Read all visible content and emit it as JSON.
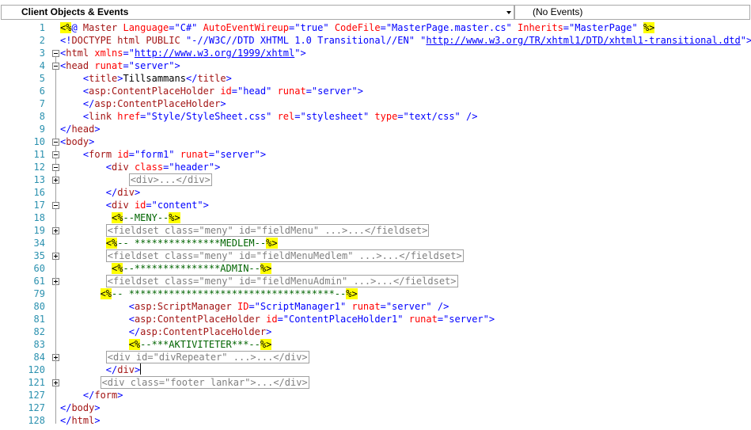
{
  "toolbar": {
    "left_dropdown": "Client Objects & Events",
    "right_dropdown": "(No Events)"
  },
  "lines": [
    {
      "num": "1",
      "fold": "",
      "ind": 0,
      "segs": [
        [
          "hl",
          "<%"
        ],
        [
          "b",
          "@ "
        ],
        [
          "m",
          "Master "
        ],
        [
          "a",
          "Language"
        ],
        [
          "b",
          "=\"C#\" "
        ],
        [
          "a",
          "AutoEventWireup"
        ],
        [
          "b",
          "=\"true\" "
        ],
        [
          "a",
          "CodeFile"
        ],
        [
          "b",
          "=\"MasterPage.master.cs\" "
        ],
        [
          "a",
          "Inherits"
        ],
        [
          "b",
          "=\"MasterPage\" "
        ],
        [
          "hl",
          "%>"
        ]
      ]
    },
    {
      "num": "2",
      "fold": "",
      "ind": 0,
      "segs": [
        [
          "b",
          "<!"
        ],
        [
          "m",
          "DOCTYPE html PUBLIC "
        ],
        [
          "b",
          "\"-//W3C//DTD XHTML 1.0 Transitional//EN\" \""
        ],
        [
          "u",
          "http://www.w3.org/TR/xhtml1/DTD/xhtml1-transitional.dtd"
        ],
        [
          "b",
          "\">"
        ]
      ]
    },
    {
      "num": "3",
      "fold": "minus",
      "ind": 0,
      "segs": [
        [
          "b",
          "<"
        ],
        [
          "m",
          "html "
        ],
        [
          "a",
          "xmlns"
        ],
        [
          "b",
          "=\""
        ],
        [
          "u",
          "http://www.w3.org/1999/xhtml"
        ],
        [
          "b",
          "\">"
        ]
      ]
    },
    {
      "num": "4",
      "fold": "minus",
      "ind": 0,
      "segs": [
        [
          "b",
          "<"
        ],
        [
          "m",
          "head "
        ],
        [
          "a",
          "runat"
        ],
        [
          "b",
          "=\"server\">"
        ]
      ]
    },
    {
      "num": "5",
      "fold": "",
      "ind": 4,
      "segs": [
        [
          "b",
          "<"
        ],
        [
          "m",
          "title"
        ],
        [
          "b",
          ">"
        ],
        [
          "t",
          "Tillsammans"
        ],
        [
          "b",
          "</"
        ],
        [
          "m",
          "title"
        ],
        [
          "b",
          ">"
        ]
      ]
    },
    {
      "num": "6",
      "fold": "",
      "ind": 4,
      "segs": [
        [
          "b",
          "<"
        ],
        [
          "m",
          "asp:ContentPlaceHolder "
        ],
        [
          "a",
          "id"
        ],
        [
          "b",
          "=\"head\" "
        ],
        [
          "a",
          "runat"
        ],
        [
          "b",
          "=\"server\">"
        ]
      ]
    },
    {
      "num": "7",
      "fold": "",
      "ind": 4,
      "segs": [
        [
          "b",
          "</"
        ],
        [
          "m",
          "asp:ContentPlaceHolder"
        ],
        [
          "b",
          ">"
        ]
      ]
    },
    {
      "num": "8",
      "fold": "",
      "ind": 4,
      "segs": [
        [
          "b",
          "<"
        ],
        [
          "m",
          "link "
        ],
        [
          "a",
          "href"
        ],
        [
          "b",
          "=\"Style/StyleSheet.css\" "
        ],
        [
          "a",
          "rel"
        ],
        [
          "b",
          "=\"stylesheet\" "
        ],
        [
          "a",
          "type"
        ],
        [
          "b",
          "=\"text/css\" />"
        ]
      ]
    },
    {
      "num": "9",
      "fold": "",
      "ind": 0,
      "segs": [
        [
          "b",
          "</"
        ],
        [
          "m",
          "head"
        ],
        [
          "b",
          ">"
        ]
      ]
    },
    {
      "num": "10",
      "fold": "minus",
      "ind": 0,
      "segs": [
        [
          "b",
          "<"
        ],
        [
          "m",
          "body"
        ],
        [
          "b",
          ">"
        ]
      ]
    },
    {
      "num": "11",
      "fold": "minus",
      "ind": 4,
      "segs": [
        [
          "b",
          "<"
        ],
        [
          "m",
          "form "
        ],
        [
          "a",
          "id"
        ],
        [
          "b",
          "=\"form1\" "
        ],
        [
          "a",
          "runat"
        ],
        [
          "b",
          "=\"server\">"
        ]
      ]
    },
    {
      "num": "12",
      "fold": "minus",
      "ind": 8,
      "segs": [
        [
          "b",
          "<"
        ],
        [
          "m",
          "div "
        ],
        [
          "a",
          "class"
        ],
        [
          "b",
          "=\"header\">"
        ]
      ]
    },
    {
      "num": "13",
      "fold": "plus",
      "ind": 12,
      "segs": [
        [
          "col",
          "<div>...</div>"
        ]
      ]
    },
    {
      "num": "16",
      "fold": "",
      "ind": 8,
      "segs": [
        [
          "b",
          "</"
        ],
        [
          "m",
          "div"
        ],
        [
          "b",
          ">"
        ]
      ]
    },
    {
      "num": "17",
      "fold": "minus",
      "ind": 8,
      "segs": [
        [
          "b",
          "<"
        ],
        [
          "m",
          "div "
        ],
        [
          "a",
          "id"
        ],
        [
          "b",
          "=\"content\">"
        ]
      ]
    },
    {
      "num": "18",
      "fold": "",
      "ind": 9,
      "segs": [
        [
          "hl",
          "<%"
        ],
        [
          "gr",
          "--MENY--"
        ],
        [
          "hl",
          "%>"
        ]
      ]
    },
    {
      "num": "19",
      "fold": "plus",
      "ind": 8,
      "segs": [
        [
          "col",
          "<fieldset class=\"meny\" id=\"fieldMenu\" ...>...</fieldset>"
        ]
      ]
    },
    {
      "num": "34",
      "fold": "",
      "ind": 8,
      "segs": [
        [
          "hl",
          "<%"
        ],
        [
          "gr",
          "-- ***************MEDLEM--"
        ],
        [
          "hl",
          "%>"
        ]
      ]
    },
    {
      "num": "35",
      "fold": "plus",
      "ind": 8,
      "segs": [
        [
          "col",
          "<fieldset class=\"meny\" id=\"fieldMenuMedlem\" ...>...</fieldset>"
        ]
      ]
    },
    {
      "num": "60",
      "fold": "",
      "ind": 9,
      "segs": [
        [
          "hl",
          "<%"
        ],
        [
          "gr",
          "--***************ADMIN--"
        ],
        [
          "hl",
          "%>"
        ]
      ]
    },
    {
      "num": "61",
      "fold": "plus",
      "ind": 8,
      "segs": [
        [
          "col",
          "<fieldset class=\"meny\" id=\"fieldMenuAdmin\" ...>...</fieldset>"
        ]
      ]
    },
    {
      "num": "79",
      "fold": "",
      "ind": 7,
      "segs": [
        [
          "hl",
          "<%"
        ],
        [
          "gr",
          "-- ************************************--"
        ],
        [
          "hl",
          "%>"
        ]
      ]
    },
    {
      "num": "80",
      "fold": "",
      "ind": 12,
      "segs": [
        [
          "b",
          "<"
        ],
        [
          "m",
          "asp:ScriptManager "
        ],
        [
          "a",
          "ID"
        ],
        [
          "b",
          "=\"ScriptManager1\" "
        ],
        [
          "a",
          "runat"
        ],
        [
          "b",
          "=\"server\" />"
        ]
      ]
    },
    {
      "num": "81",
      "fold": "",
      "ind": 12,
      "segs": [
        [
          "b",
          "<"
        ],
        [
          "m",
          "asp:ContentPlaceHolder "
        ],
        [
          "a",
          "id"
        ],
        [
          "b",
          "=\"ContentPlaceHolder1\" "
        ],
        [
          "a",
          "runat"
        ],
        [
          "b",
          "=\"server\">"
        ]
      ]
    },
    {
      "num": "82",
      "fold": "",
      "ind": 12,
      "segs": [
        [
          "b",
          "</"
        ],
        [
          "m",
          "asp:ContentPlaceHolder"
        ],
        [
          "b",
          ">"
        ]
      ]
    },
    {
      "num": "83",
      "fold": "",
      "ind": 12,
      "segs": [
        [
          "hl",
          "<%"
        ],
        [
          "gr",
          "--***AKTIVITETER***--"
        ],
        [
          "hl",
          "%>"
        ]
      ]
    },
    {
      "num": "84",
      "fold": "plus",
      "ind": 8,
      "segs": [
        [
          "col",
          "<div id=\"divRepeater\" ...>...</div>"
        ]
      ]
    },
    {
      "num": "120",
      "fold": "",
      "ind": 8,
      "segs": [
        [
          "b",
          "</"
        ],
        [
          "m",
          "div"
        ],
        [
          "b",
          ">"
        ],
        [
          "cursor",
          ""
        ]
      ]
    },
    {
      "num": "121",
      "fold": "plus",
      "ind": 7,
      "segs": [
        [
          "col",
          "<div class=\"footer lankar\">...</div>"
        ]
      ]
    },
    {
      "num": "127",
      "fold": "",
      "ind": 4,
      "segs": [
        [
          "b",
          "</"
        ],
        [
          "m",
          "form"
        ],
        [
          "b",
          ">"
        ]
      ]
    },
    {
      "num": "127",
      "fold": "",
      "ind": 0,
      "segs": [
        [
          "b",
          "</"
        ],
        [
          "m",
          "body"
        ],
        [
          "b",
          ">"
        ]
      ]
    },
    {
      "num": "128",
      "fold": "",
      "ind": 0,
      "segs": [
        [
          "b",
          "</"
        ],
        [
          "m",
          "html"
        ],
        [
          "b",
          ">"
        ]
      ]
    }
  ]
}
